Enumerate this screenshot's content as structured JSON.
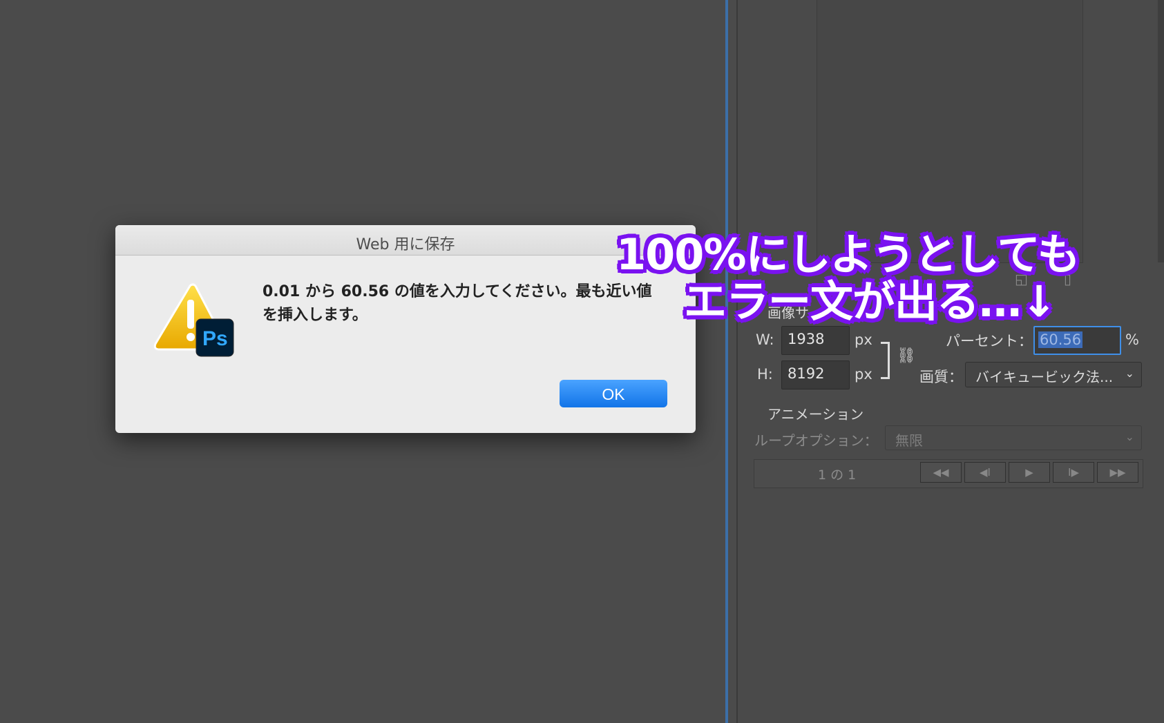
{
  "dialog": {
    "title": "Web 用に保存",
    "message": "0.01 から 60.56 の値を入力してください。最も近い値を挿入します。",
    "ok_label": "OK",
    "app_badge": "Ps"
  },
  "caption": {
    "line1": "100%にしようとしても",
    "line2": "エラー文が出る…↓"
  },
  "image_size": {
    "section_label": "画像サ…",
    "width_label": "W:",
    "width_value": "1938",
    "height_label": "H:",
    "height_value": "8192",
    "unit": "px",
    "percent_label": "パーセント：",
    "percent_value": "60.56",
    "percent_unit": "%",
    "quality_label": "画質：",
    "quality_value": "バイキュービック法..."
  },
  "animation": {
    "section_label": "アニメーション",
    "loop_label": "ループオプション：",
    "loop_value": "無限",
    "frame_counter": "1 の 1",
    "nav_buttons": [
      "◀◀",
      "◀I",
      "▶",
      "I▶",
      "▶▶"
    ]
  },
  "colors": {
    "accent": "#3f8fe9",
    "caption_stroke": "#7a12f0",
    "ok_button": "#1274e8"
  }
}
